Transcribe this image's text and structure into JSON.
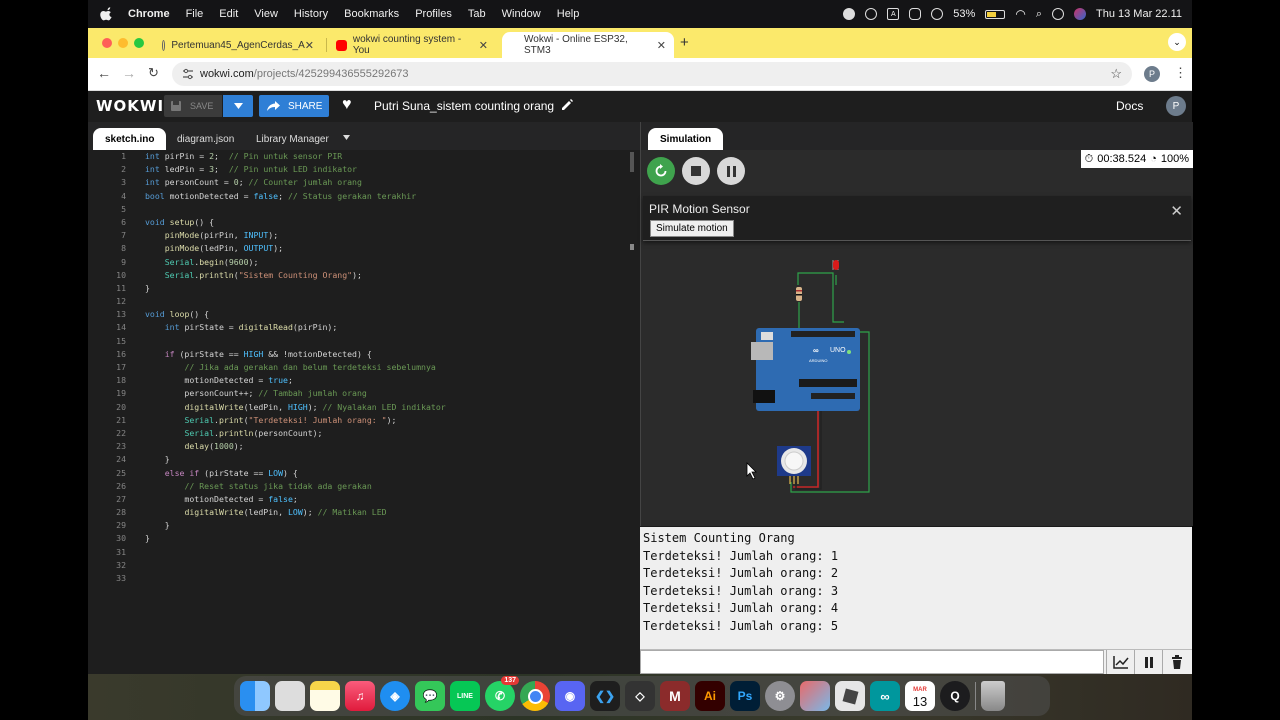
{
  "menubar": {
    "app": "Chrome",
    "items": [
      "File",
      "Edit",
      "View",
      "History",
      "Bookmarks",
      "Profiles",
      "Tab",
      "Window",
      "Help"
    ],
    "input_source": "A",
    "battery": "53%",
    "datetime": "Thu 13 Mar  22.11"
  },
  "browser": {
    "tabs": [
      {
        "title": "Pertemuan45_AgenCerdas_A",
        "close": "✕"
      },
      {
        "title": "wokwi counting system - You",
        "close": "✕"
      },
      {
        "title": "Wokwi - Online ESP32, STM3",
        "close": "✕"
      }
    ],
    "url_host": "wokwi.com",
    "url_path": "/projects/425299436555292673",
    "profile_initial": "P"
  },
  "wokwi": {
    "logo": "WOKWI",
    "save_label": "SAVE",
    "share_label": "SHARE",
    "project_title": "Putri Suna_sistem counting orang",
    "docs_label": "Docs",
    "avatar_initial": "P"
  },
  "editor": {
    "tabs": [
      "sketch.ino",
      "diagram.json",
      "Library Manager"
    ],
    "active_tab": "sketch.ino",
    "code_lines": [
      "int pirPin = 2;  // Pin untuk sensor PIR",
      "int ledPin = 3;  // Pin untuk LED indikator",
      "int personCount = 0; // Counter jumlah orang",
      "bool motionDetected = false; // Status gerakan terakhir",
      "",
      "void setup() {",
      "    pinMode(pirPin, INPUT);",
      "    pinMode(ledPin, OUTPUT);",
      "    Serial.begin(9600);",
      "    Serial.println(\"Sistem Counting Orang\");",
      "}",
      "",
      "void loop() {",
      "    int pirState = digitalRead(pirPin);",
      "",
      "    if (pirState == HIGH && !motionDetected) {",
      "        // Jika ada gerakan dan belum terdeteksi sebelumnya",
      "        motionDetected = true;",
      "        personCount++; // Tambah jumlah orang",
      "        digitalWrite(ledPin, HIGH); // Nyalakan LED indikator",
      "        Serial.print(\"Terdeteksi! Jumlah orang: \");",
      "        Serial.println(personCount);",
      "        delay(1000);",
      "    }",
      "    else if (pirState == LOW) {",
      "        // Reset status jika tidak ada gerakan",
      "        motionDetected = false;",
      "        digitalWrite(ledPin, LOW); // Matikan LED",
      "    }",
      "}",
      "",
      "",
      ""
    ]
  },
  "simulation": {
    "tab_label": "Simulation",
    "timer": "00:38.524",
    "speed": "100%",
    "pir_panel_title": "PIR Motion Sensor",
    "simulate_button": "Simulate motion",
    "close": "✕",
    "board_label": "UNO",
    "board_brand": "ARDUINO"
  },
  "serial_monitor": {
    "lines": [
      "Sistem Counting Orang",
      "Terdeteksi! Jumlah orang: 1",
      "Terdeteksi! Jumlah orang: 2",
      "Terdeteksi! Jumlah orang: 3",
      "Terdeteksi! Jumlah orang: 4",
      "Terdeteksi! Jumlah orang: 5"
    ]
  },
  "dock": {
    "icons": [
      "finder-icon",
      "launchpad-icon",
      "notes-icon",
      "music-icon",
      "safari-icon",
      "messages-icon",
      "line-icon",
      "whatsapp-icon",
      "chrome-icon",
      "discord-icon",
      "vscode-icon",
      "unity-icon",
      "mendeley-icon",
      "illustrator-icon",
      "photoshop-icon",
      "system-settings-icon",
      "iphone-mirroring-icon",
      "roblox-icon",
      "arduino-icon",
      "calendar-icon",
      "quicktime-icon",
      "trash-icon"
    ],
    "whatsapp_badge": "137",
    "calendar_month": "MAR",
    "calendar_day": "13",
    "illustrator_label": "Ai",
    "photoshop_label": "Ps"
  },
  "colors": {
    "tab_strip": "#fbe96b",
    "wokwi_blue": "#2f7fd6",
    "run_green": "#3fa34d",
    "board_blue": "#2e6bb2"
  }
}
